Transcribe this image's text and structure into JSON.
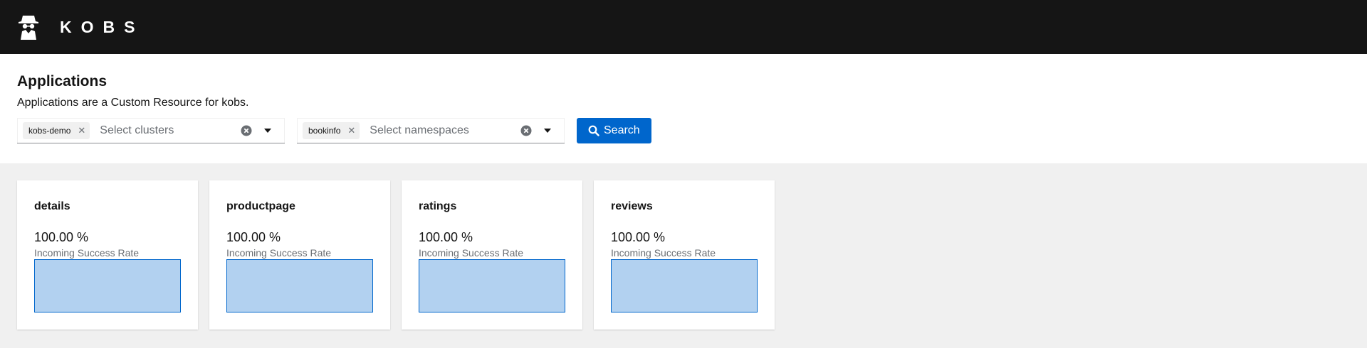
{
  "header": {
    "brand": "KOBS",
    "logo_icon": "spy-icon"
  },
  "page": {
    "title": "Applications",
    "description": "Applications are a Custom Resource for kobs."
  },
  "filters": {
    "clusters": {
      "chip": "kobs-demo",
      "placeholder": "Select clusters"
    },
    "namespaces": {
      "chip": "bookinfo",
      "placeholder": "Select namespaces"
    },
    "search_label": "Search"
  },
  "colors": {
    "accent": "#0066cc",
    "chart_fill": "#b2d1f0",
    "masthead": "#151515"
  },
  "cards": [
    {
      "title": "details",
      "value": "100.00 %",
      "label": "Incoming Success Rate"
    },
    {
      "title": "productpage",
      "value": "100.00 %",
      "label": "Incoming Success Rate"
    },
    {
      "title": "ratings",
      "value": "100.00 %",
      "label": "Incoming Success Rate"
    },
    {
      "title": "reviews",
      "value": "100.00 %",
      "label": "Incoming Success Rate"
    }
  ]
}
